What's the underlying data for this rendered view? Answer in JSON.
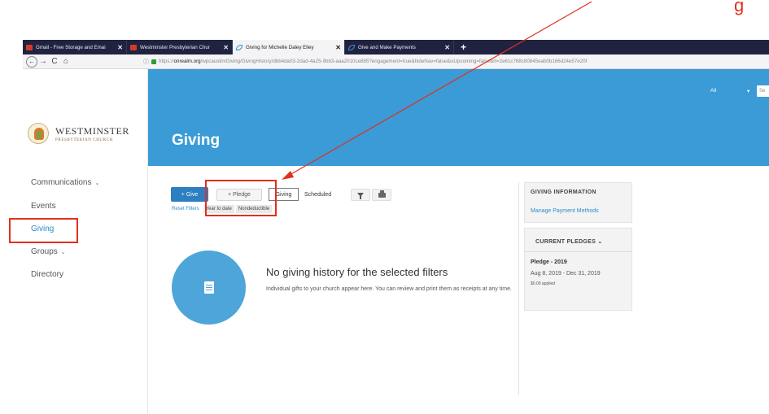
{
  "annotation": {
    "text": "g",
    "color": "#e0301e"
  },
  "browser": {
    "tabs": [
      {
        "label": "Gmail - Free Storage and Emai",
        "close": "✕"
      },
      {
        "label": "Westminster Presbyterian Chur",
        "close": "✕"
      },
      {
        "label": "Giving for Michelle Daley Elley",
        "close": "✕"
      },
      {
        "label": "Give and Make Payments",
        "close": "✕"
      }
    ],
    "new_tab": "+",
    "nav": {
      "back": "←",
      "forward": "→",
      "reload": "C",
      "home": "⌂"
    },
    "url": {
      "info": "ⓘ",
      "prefix": "https://",
      "domain": "onrealm.org",
      "path": "/wpcaustin/Giving/GivingHistory/dbb4da03-2dad-4a25-9bb3-aaa2010ce885?engagement=true&hideNav=false&isUpcoming=false&rt=2e61c768c80845eab0b166d24e57e20f"
    }
  },
  "sidebar": {
    "logo": {
      "name": "WESTMINSTER",
      "subtitle": "PRESBYTERIAN CHURCH"
    },
    "items": [
      {
        "label": "Communications",
        "chevron": "⌄"
      },
      {
        "label": "Events"
      },
      {
        "label": "Giving"
      },
      {
        "label": "Groups",
        "chevron": "⌄"
      },
      {
        "label": "Directory"
      }
    ]
  },
  "header": {
    "title": "Giving",
    "filter_label": "All",
    "filter_chevron": "▾",
    "search_placeholder": "Se"
  },
  "toolbar": {
    "give_label": "+ Give",
    "pledge_label": "+ Pledge",
    "tabs": [
      "Giving",
      "Scheduled"
    ]
  },
  "filters": {
    "reset": "Reset Filters",
    "chips": [
      "Year to date",
      "Nondeductible"
    ]
  },
  "empty_state": {
    "title": "No giving history for the selected filters",
    "description": "Individual gifts to your church appear here. You can review and print them as receipts at any time."
  },
  "giving_information": {
    "heading": "GIVING INFORMATION",
    "link": "Manage Payment Methods"
  },
  "current_pledges": {
    "heading": "CURRENT PLEDGES",
    "chevron": "⌄",
    "pledge": {
      "name": "Pledge - 2019",
      "dates": "Aug 8, 2019 - Dec 31, 2019",
      "applied": "$0.00 applied"
    }
  }
}
